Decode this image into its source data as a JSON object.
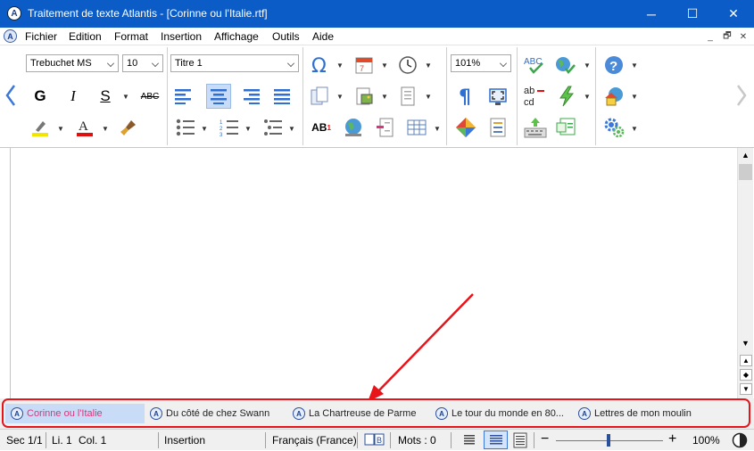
{
  "window": {
    "title": "Traitement de texte Atlantis - [Corinne ou l'Italie.rtf]",
    "minimize": "─",
    "maximize": "☐",
    "close": "✕"
  },
  "menu": {
    "items": [
      "Fichier",
      "Edition",
      "Format",
      "Insertion",
      "Affichage",
      "Outils",
      "Aide"
    ],
    "mdi": {
      "minimize": "_",
      "restore": "🗗",
      "close": "✕"
    }
  },
  "toolbar": {
    "font_name": "Trebuchet MS",
    "font_size": "10",
    "style": "Titre 1",
    "zoom": "101%",
    "bold": "G",
    "italic": "I",
    "underline": "S",
    "strikethrough": "ABC",
    "superscript": "AB",
    "superscript_exp": "1",
    "spell_top": "ABC",
    "replace_top": "ab",
    "replace_bottom": "cd"
  },
  "documents": {
    "tabs": [
      {
        "label": "Corinne ou l'Italie",
        "active": true
      },
      {
        "label": "Du côté de chez Swann",
        "active": false
      },
      {
        "label": "La Chartreuse de Parme",
        "active": false
      },
      {
        "label": "Le tour du monde en 80...",
        "active": false
      },
      {
        "label": "Lettres de mon moulin",
        "active": false
      }
    ]
  },
  "status": {
    "section": "Sec 1/1",
    "line": "Li. 1",
    "column": "Col. 1",
    "mode": "Insertion",
    "language": "Français (France)",
    "words": "Mots : 0",
    "zoom": "100%",
    "zoom_minus": "−",
    "zoom_plus": "+"
  },
  "colors": {
    "titlebar": "#0b5cc7",
    "annotation": "#e8141a",
    "active_tab_text": "#d9357a",
    "active_tab_bg": "#c9dcf7"
  }
}
